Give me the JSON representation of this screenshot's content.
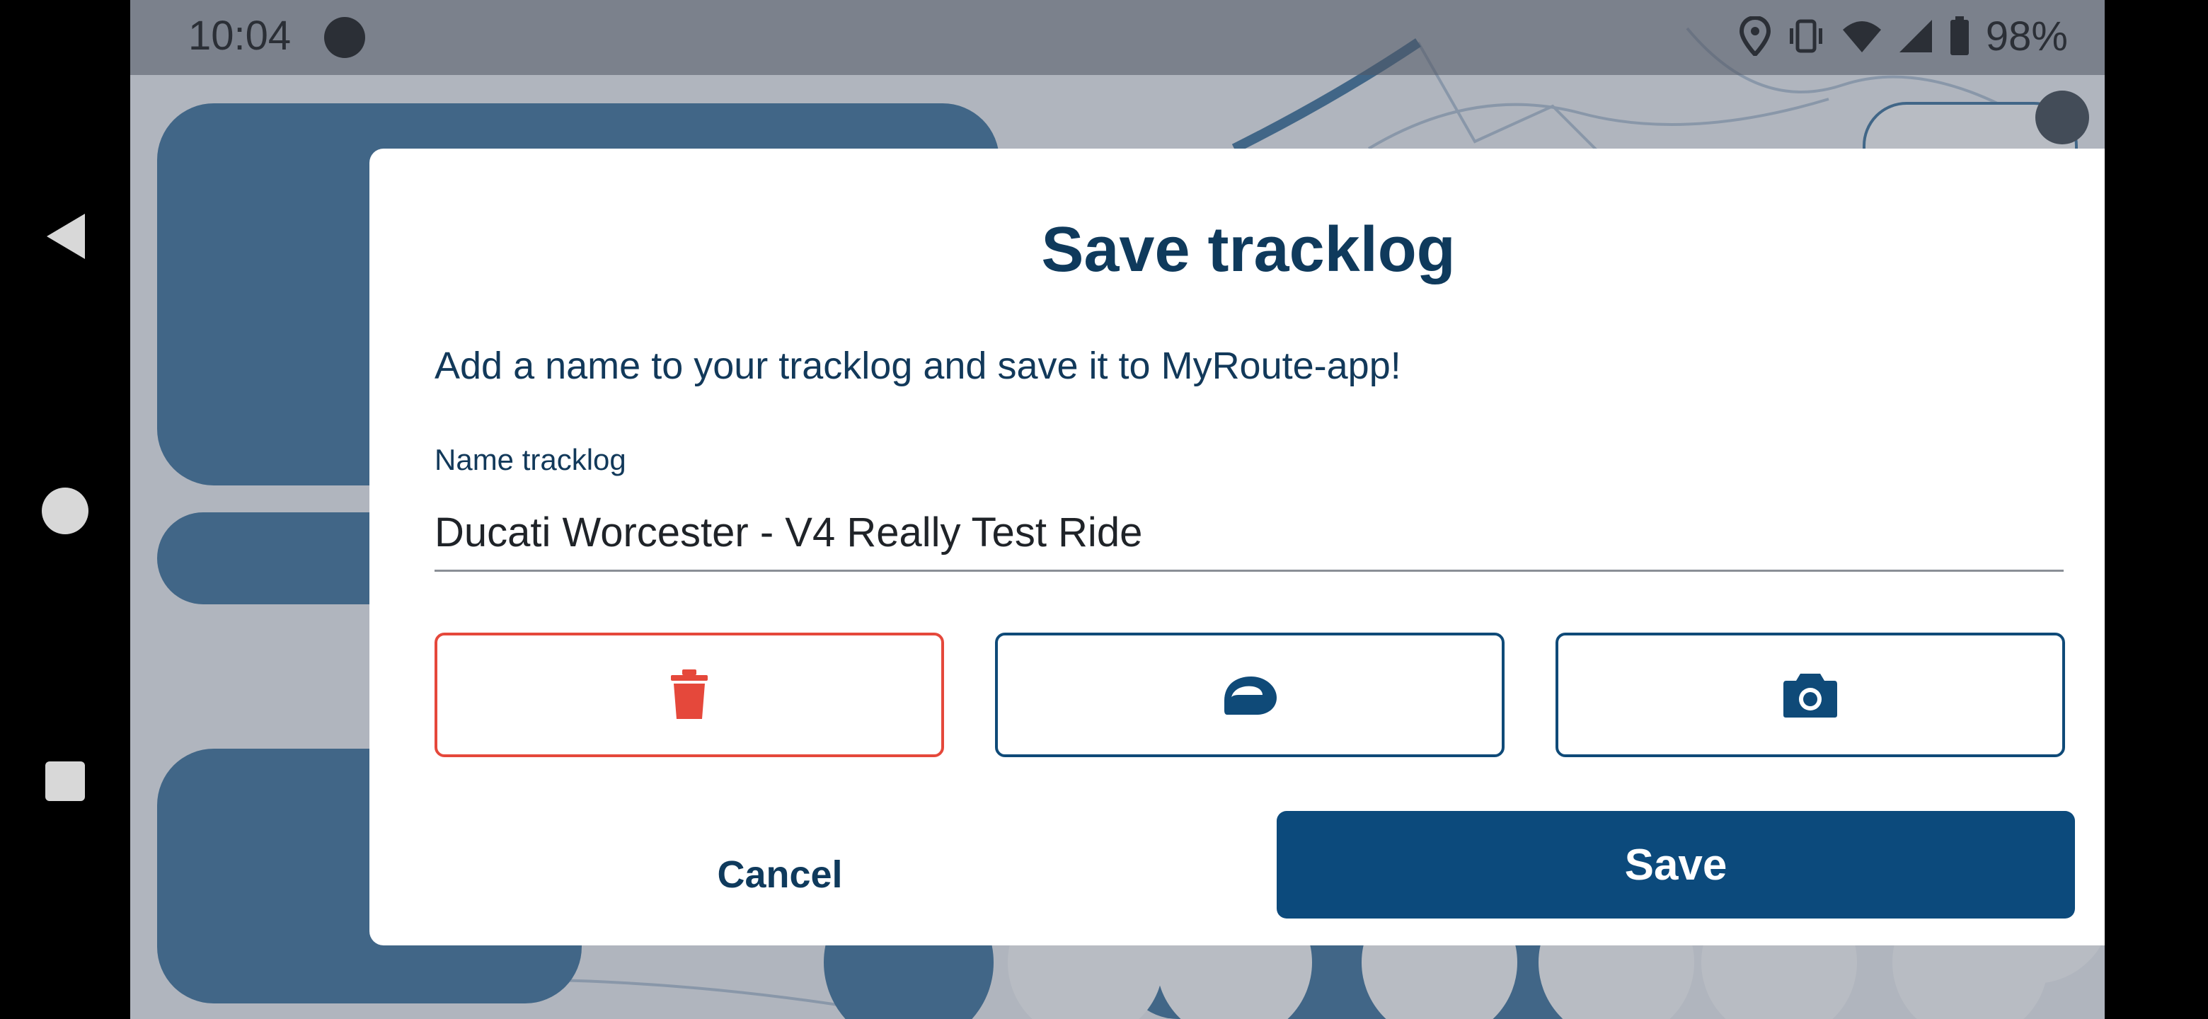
{
  "status_bar": {
    "time": "10:04",
    "battery_percent": "98%",
    "icons": [
      "location-icon",
      "vibrate-icon",
      "wifi-icon",
      "signal-icon",
      "battery-icon"
    ]
  },
  "nav_bar": {
    "buttons": [
      "back-icon",
      "home-icon",
      "recents-icon"
    ]
  },
  "dialog": {
    "title": "Save tracklog",
    "description": "Add a name to your tracklog and save it to MyRoute-app!",
    "name_field": {
      "label": "Name tracklog",
      "value": "Ducati Worcester - V4 Really Test Ride"
    },
    "actions": [
      {
        "icon": "trash-icon",
        "color": "#e5483b"
      },
      {
        "icon": "helmet-icon",
        "color": "#0f4a78"
      },
      {
        "icon": "camera-icon",
        "color": "#0f4a78"
      }
    ],
    "cancel_label": "Cancel",
    "save_label": "Save"
  },
  "colors": {
    "primary": "#0c4a7c",
    "danger": "#e5483b",
    "title": "#0f3a5c"
  }
}
